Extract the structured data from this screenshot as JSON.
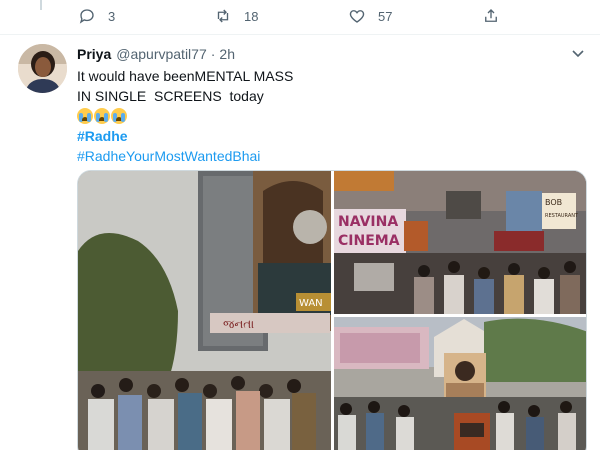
{
  "prev_tweet": {
    "actions": [
      {
        "icon": "reply-icon",
        "count": "3"
      },
      {
        "icon": "retweet-icon",
        "count": "18"
      },
      {
        "icon": "like-icon",
        "count": "57"
      },
      {
        "icon": "share-icon",
        "count": ""
      }
    ]
  },
  "tweet": {
    "author": {
      "name": "Priya",
      "handle": "@apurvpatil77",
      "separator": "·",
      "time": "2h"
    },
    "text_lines": [
      "It would have beenMENTAL MASS",
      "IN SINGLE  SCREENS  today"
    ],
    "emoji_count": 3,
    "hashtags": [
      "#Radhe",
      "#RadheYourMostWantedBhai"
    ],
    "media": {
      "sign_left": "જનતા",
      "sign_left_badge": "WAN",
      "sign_top_right": [
        "NAVINA",
        "CINEMA"
      ],
      "sign_bob": [
        "BOB",
        "RESTAURANT"
      ]
    }
  },
  "colors": {
    "link": "#1d9bf0",
    "secondary_text": "#536471",
    "border": "#cfd9de"
  }
}
